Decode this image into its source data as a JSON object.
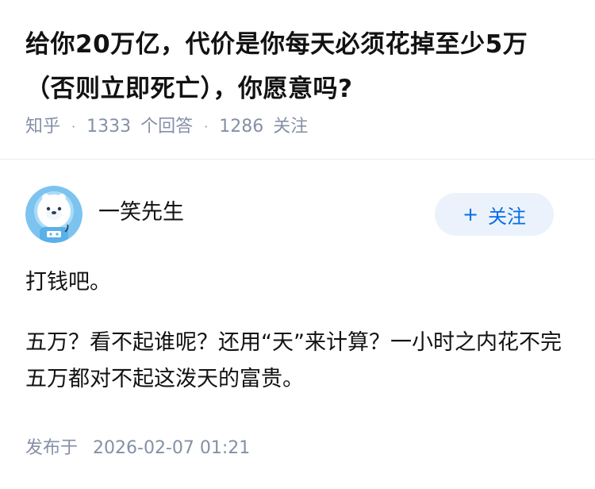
{
  "question": {
    "title": "给你20万亿，代价是你每天必须花掉至少5万（否则立即死亡），你愿意吗?",
    "source": "知乎",
    "answer_count": "1333",
    "answer_count_label": "个回答",
    "follower_count": "1286",
    "follower_count_label": "关注"
  },
  "author": {
    "name": "一笑先生",
    "avatar_icon": "polar-bear-astronaut-avatar",
    "follow_label": "关注"
  },
  "answer": {
    "paragraphs": [
      "打钱吧。",
      "五万？看不起谁呢？还用“天”来计算？一小时之内花不完五万都对不起这泼天的富贵。"
    ],
    "published_label": "发布于",
    "published_time": "2026-02-07 01:21"
  },
  "colors": {
    "meta_gray": "#8590a6",
    "accent_blue": "#056de8",
    "follow_button_bg": "#ebf2fb",
    "avatar_bg": "#7dc3f0"
  }
}
